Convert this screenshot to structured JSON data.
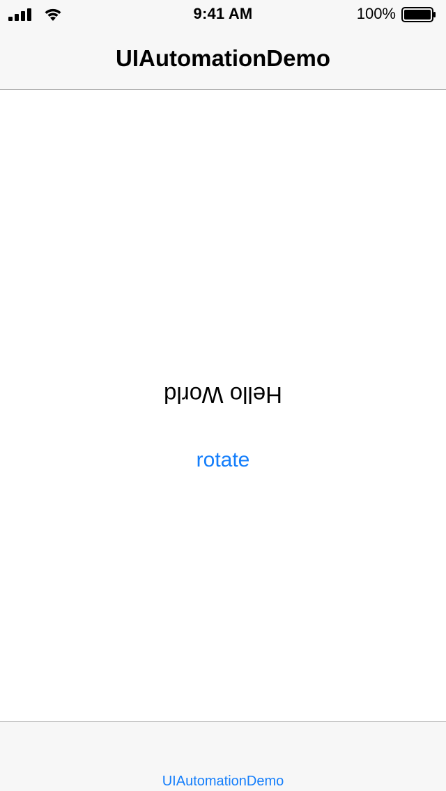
{
  "status_bar": {
    "time": "9:41 AM",
    "battery_percent": "100%",
    "battery_level": 1.0,
    "signal_icon": "cellular-signal-icon",
    "wifi_icon": "wifi-icon",
    "battery_icon": "battery-icon"
  },
  "nav_bar": {
    "title": "UIAutomationDemo"
  },
  "main": {
    "label_text": "Hello World",
    "rotate_button_label": "rotate"
  },
  "tab_bar": {
    "items": [
      {
        "label": "UIAutomationDemo"
      }
    ]
  },
  "colors": {
    "accent": "#147efb",
    "bar_background": "#f7f7f7",
    "separator": "#b2b2b2"
  }
}
